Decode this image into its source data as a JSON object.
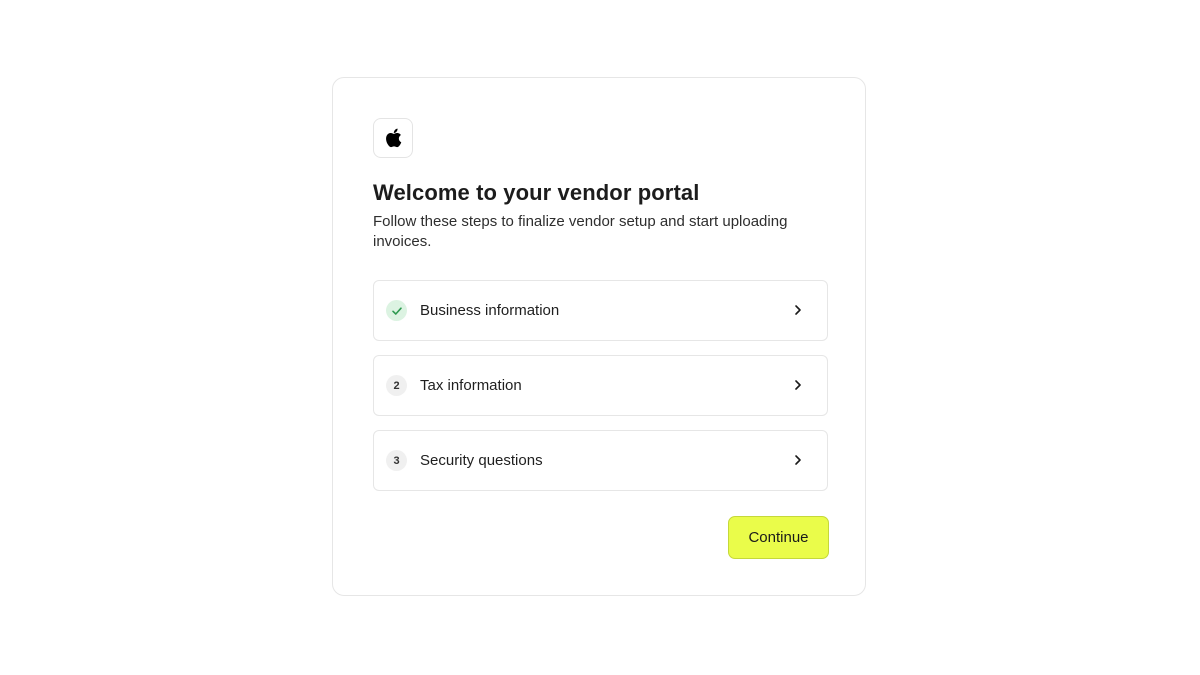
{
  "logo": {
    "icon": "apple-logo-icon"
  },
  "header": {
    "title": "Welcome to your vendor portal",
    "subtitle": "Follow these steps to finalize vendor setup and start uploading invoices."
  },
  "steps": [
    {
      "badge": "",
      "status": "completed",
      "icon": "check-icon",
      "label": "Business information"
    },
    {
      "badge": "2",
      "status": "pending",
      "label": "Tax information"
    },
    {
      "badge": "3",
      "status": "pending",
      "label": "Security questions"
    }
  ],
  "actions": {
    "continue_label": "Continue"
  },
  "colors": {
    "accent": "#eafc4a",
    "check": "#2e9a50",
    "check_bg": "#dcf3e2"
  }
}
